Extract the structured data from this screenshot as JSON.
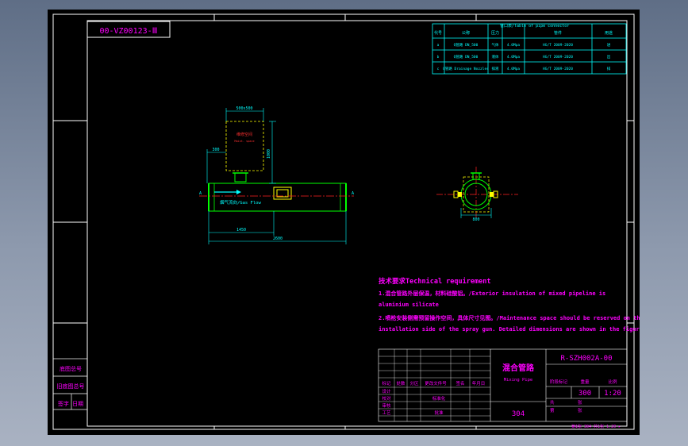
{
  "drawing": {
    "ref_code": "00-VZ00123-Ⅲ",
    "part_number": "R-SZH002A-00",
    "title_cn": "混合管路",
    "title_en": "Mixing Pipe",
    "material": "304",
    "scale_label": "比例",
    "scale": "1:20",
    "sheet_count": "300",
    "footer_note": "第1张 304  共1张 1.20 ▸"
  },
  "nozzle_table": {
    "header": [
      "代号",
      "公称",
      "压力",
      "管件",
      "用途"
    ],
    "caption": "管口表/Table of pipe connector",
    "rows": [
      [
        "a",
        "Q管路\nDN_500",
        "气体",
        "4.0Mpa",
        "HG/T 2009-2020",
        "进"
      ],
      [
        "b",
        "Q管路\nDN_500",
        "液体",
        "4.0Mpa",
        "HG/T 2009-2020",
        "出"
      ],
      [
        "c",
        "Q管路\nDrainage Nozzles",
        "排液",
        "4.0Mpa",
        "HG/T 2009-2020",
        "排"
      ]
    ]
  },
  "elevation": {
    "maint_label": "维修空间",
    "maint_sub": "Maint. space",
    "flow_label": "烟气流向/Gas Flow",
    "dim_top": "500x500",
    "dim_stub": "300",
    "dim_height": "1000",
    "dim_left": "1450",
    "dim_total": "2600",
    "end_a": "A",
    "end_b": "A"
  },
  "section": {
    "dim_width": "800"
  },
  "tech_req": {
    "heading": "技术要求Technical requirement",
    "lines": [
      "1.混合管路外层保温，材料硅酸铝。/Exterior insulation of mixed pipeline is",
      "aluminium silicate",
      "2.喷枪安装侧需预留操作空间，具体尺寸见图。/Maintenance space should be reserved on the",
      "installation side of the spray gun. Detailed dimensions are shown in the figure."
    ]
  },
  "title_block": {
    "left_labels": [
      "底图总号",
      "旧底图总号",
      "签字  日期"
    ],
    "col_labels": [
      "标记",
      "处数",
      "分区",
      "更改文件号",
      "签名",
      "年月日"
    ],
    "role_labels": [
      "设计",
      "校对",
      "审核",
      "工艺",
      "标准化",
      "批准"
    ],
    "weight_labels": [
      "阶段标记",
      "重量",
      "比例"
    ],
    "sheet_labels": [
      "共",
      "张",
      "第",
      "张"
    ]
  },
  "colors": {
    "background": "#000000",
    "frame": "#ffffff",
    "text": "#ff00ff",
    "dims": "#00ffff",
    "pipe": "#00ff00",
    "centerline": "#ff2020",
    "hidden": "#ffff00",
    "callout": "#ff3030"
  }
}
